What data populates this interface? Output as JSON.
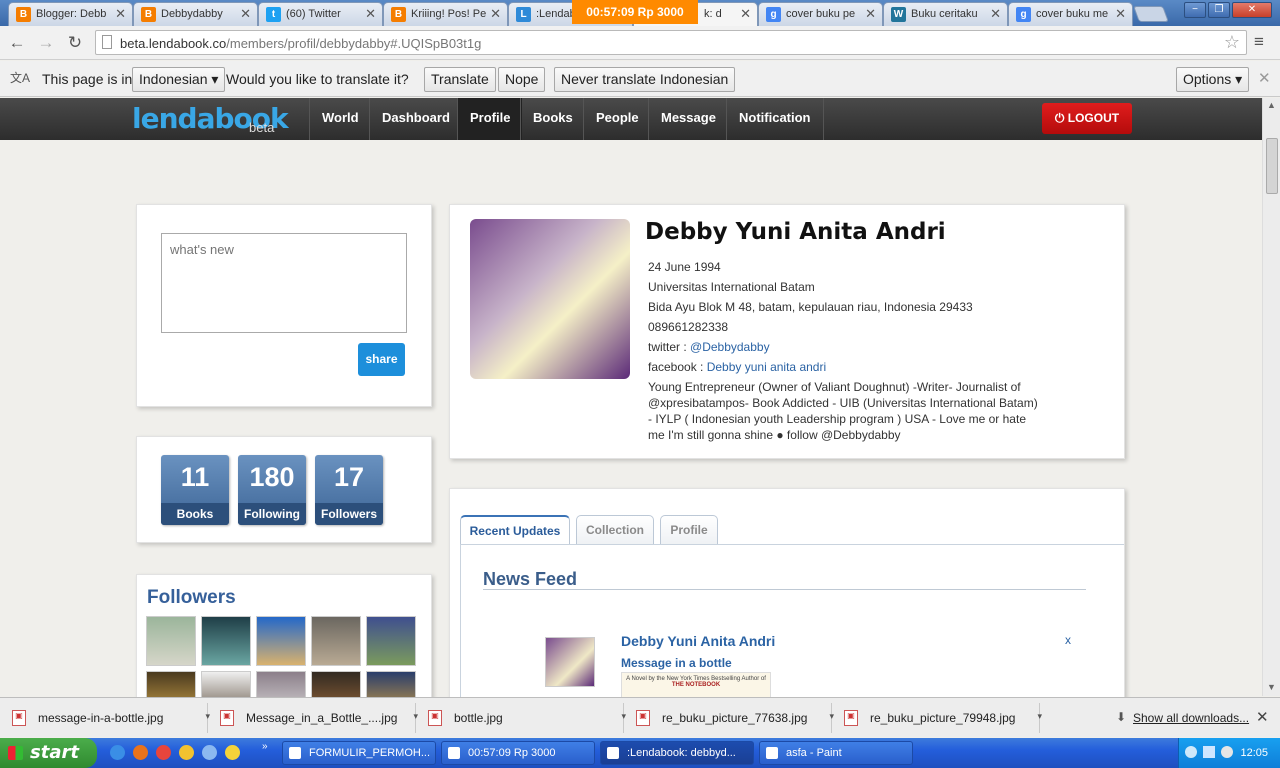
{
  "browser": {
    "tabs": [
      {
        "label": "Blogger: Debb",
        "fav": "B",
        "color": "#f57d00"
      },
      {
        "label": "Debbydabby",
        "fav": "B",
        "color": "#f57d00"
      },
      {
        "label": "(60) Twitter",
        "fav": "t",
        "color": "#1da1f2"
      },
      {
        "label": "Kriiing! Pos! Pe",
        "fav": "B",
        "color": "#f57d00"
      },
      {
        "label": ":Lendab",
        "fav": "L",
        "color": "#2e8ad8"
      },
      {
        "label": "k: d",
        "fav": "",
        "color": "#888888"
      },
      {
        "label": "cover buku pe",
        "fav": "g",
        "color": "#4285f4"
      },
      {
        "label": "Buku ceritaku",
        "fav": "W",
        "color": "#21759b"
      },
      {
        "label": "cover buku me",
        "fav": "g",
        "color": "#4285f4"
      }
    ],
    "timer_overlay": "00:57:09  Rp 3000",
    "url_host": "beta.lendabook.co",
    "url_path": "/members/profil/debbydabby#.UQISpB03t1g",
    "window_min": "−",
    "window_max": "❐",
    "window_close": "✕"
  },
  "translate_bar": {
    "prefix": "This page is in",
    "language": "Indonesian",
    "question": "Would you like to translate it?",
    "translate_btn": "Translate",
    "nope_btn": "Nope",
    "never_btn": "Never translate Indonesian",
    "options_btn": "Options"
  },
  "site": {
    "logo": "lendabook",
    "logo_sub": "beta",
    "nav": [
      "World",
      "Dashboard",
      "Profile",
      "Books",
      "People",
      "Message",
      "Notification"
    ],
    "active_nav": "Profile",
    "logout": "LOGOUT"
  },
  "composer": {
    "placeholder": "what's new",
    "share": "share"
  },
  "stats": [
    {
      "num": "11",
      "label": "Books"
    },
    {
      "num": "180",
      "label": "Following"
    },
    {
      "num": "17",
      "label": "Followers"
    }
  ],
  "followers": {
    "title": "Followers"
  },
  "profile": {
    "name": "Debby Yuni Anita Andri",
    "birthday": "24 June 1994",
    "school": "Universitas International Batam",
    "address": "Bida Ayu Blok M 48, batam, kepulauan riau, Indonesia 29433",
    "phone": "089661282338",
    "twitter_label": "twitter :",
    "twitter": "@Debbydabby",
    "facebook_label": "facebook :",
    "facebook": "Debby yuni anita andri",
    "bio": "Young Entrepreneur (Owner of Valiant Doughnut) -Writer- Journalist of @xpresibatampos- Book Addicted - UIB (Universitas International Batam) - IYLP ( Indonesian youth Leadership program ) USA - Love me or hate me I'm still gonna shine ● follow @Debbydabby"
  },
  "feed": {
    "tabs": [
      "Recent Updates",
      "Collection",
      "Profile"
    ],
    "title": "News Feed",
    "item_name": "Debby Yuni Anita Andri",
    "item_message": "Message in a bottle",
    "item_close": "x",
    "book_blurb": "A Novel by the New York Times Bestselling Author of",
    "book_title": "THE NOTEBOOK"
  },
  "downloads": {
    "items": [
      "message-in-a-bottle.jpg",
      "Message_in_a_Bottle_....jpg",
      "bottle.jpg",
      "re_buku_picture_77638.jpg",
      "re_buku_picture_79948.jpg"
    ],
    "show_all": "Show all downloads..."
  },
  "taskbar": {
    "start": "start",
    "tasks": [
      "FORMULIR_PERMOH...",
      "00:57:09 Rp 3000",
      ":Lendabook: debbyd...",
      "asfa - Paint"
    ],
    "clock": "12:05"
  }
}
